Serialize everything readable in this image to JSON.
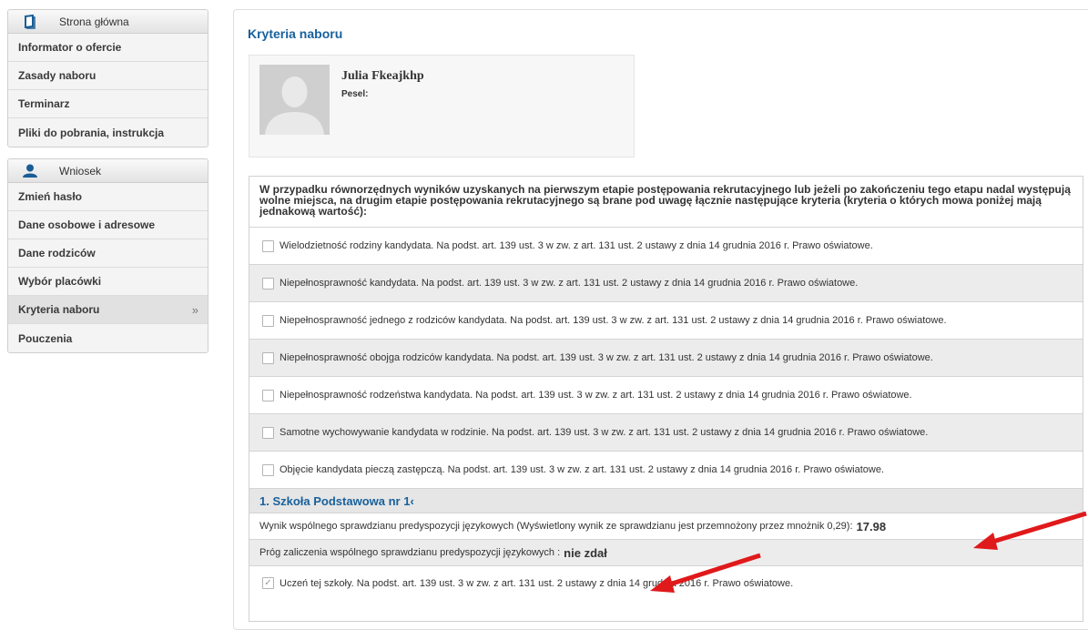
{
  "sidebar": {
    "group1": {
      "header": "Strona główna",
      "items": [
        {
          "label": "Informator o ofercie"
        },
        {
          "label": "Zasady naboru"
        },
        {
          "label": "Terminarz"
        },
        {
          "label": "Pliki do pobrania, instrukcja"
        }
      ]
    },
    "group2": {
      "header": "Wniosek",
      "items": [
        {
          "label": "Zmień hasło"
        },
        {
          "label": "Dane osobowe i adresowe"
        },
        {
          "label": "Dane rodziców"
        },
        {
          "label": "Wybór placówki"
        },
        {
          "label": "Kryteria naboru",
          "active": true,
          "chevron": "»"
        },
        {
          "label": "Pouczenia"
        }
      ]
    }
  },
  "main": {
    "title": "Kryteria naboru",
    "profile": {
      "name": "Julia Fkeajkhp",
      "pesel_label": "Pesel:"
    },
    "intro": "W przypadku równorzędnych wyników uzyskanych na pierwszym etapie postępowania rekrutacyjnego lub jeżeli po zakończeniu tego etapu nadal występują wolne miejsca, na drugim etapie postępowania rekrutacyjnego są brane pod uwagę łącznie następujące kryteria (kryteria o których mowa poniżej mają jednakową wartość):",
    "criteria": [
      {
        "label": "Wielodzietność rodziny kandydata. Na podst. art. 139 ust. 3 w zw. z art. 131 ust. 2 ustawy z dnia 14 grudnia 2016 r. Prawo oświatowe.",
        "checked": false
      },
      {
        "label": "Niepełnosprawność kandydata. Na podst. art. 139 ust. 3 w zw. z art. 131 ust. 2 ustawy z dnia 14 grudnia 2016 r. Prawo oświatowe.",
        "checked": false
      },
      {
        "label": "Niepełnosprawność jednego z rodziców kandydata. Na podst. art. 139 ust. 3 w zw. z art. 131 ust. 2 ustawy z dnia 14 grudnia 2016 r. Prawo oświatowe.",
        "checked": false
      },
      {
        "label": "Niepełnosprawność obojga rodziców kandydata. Na podst. art. 139 ust. 3 w zw. z art. 131 ust. 2 ustawy z dnia 14 grudnia 2016 r. Prawo oświatowe.",
        "checked": false
      },
      {
        "label": "Niepełnosprawność rodzeństwa kandydata. Na podst. art. 139 ust. 3 w zw. z art. 131 ust. 2 ustawy z dnia 14 grudnia 2016 r. Prawo oświatowe.",
        "checked": false
      },
      {
        "label": "Samotne wychowywanie kandydata w rodzinie. Na podst. art. 139 ust. 3 w zw. z art. 131 ust. 2 ustawy z dnia 14 grudnia 2016 r. Prawo oświatowe.",
        "checked": false
      },
      {
        "label": "Objęcie kandydata pieczą zastępczą. Na podst. art. 139 ust. 3 w zw. z art. 131 ust. 2 ustawy z dnia 14 grudnia 2016 r. Prawo oświatowe.",
        "checked": false
      }
    ],
    "school": {
      "name": "1. Szkoła Podstawowa nr 1‹",
      "test_result_label": "Wynik wspólnego sprawdzianu predyspozycji językowych (Wyświetlony wynik ze sprawdzianu jest przemnożony przez mnożnik 0,29):",
      "test_result_value": "17.98",
      "threshold_label": "Próg zaliczenia wspólnego sprawdzianu predyspozycji językowych :",
      "threshold_value": "nie zdał",
      "student_criterion": {
        "label": "Uczeń tej szkoły. Na podst. art. 139 ust. 3 w zw. z art. 131 ust. 2 ustawy z dnia 14 grudnia 2016 r. Prawo oświatowe.",
        "checked": true
      }
    }
  },
  "colors": {
    "accent": "#18619c",
    "annotation_arrow": "#e0191b"
  },
  "icons": [
    "book-icon",
    "user-icon",
    "chevron-right-icon",
    "checkbox",
    "avatar-placeholder"
  ]
}
